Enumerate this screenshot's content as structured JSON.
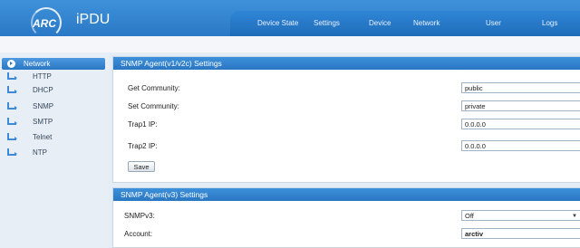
{
  "header": {
    "logo_mark": "ARC",
    "app_title": "iPDU",
    "nav": [
      "Device State",
      "Settings",
      "Device",
      "Network",
      "User",
      "Logs"
    ]
  },
  "sidebar": {
    "items": [
      {
        "label": "Network",
        "active": true
      },
      {
        "label": "HTTP"
      },
      {
        "label": "DHCP"
      },
      {
        "label": "SNMP"
      },
      {
        "label": "SMTP"
      },
      {
        "label": "Telnet"
      },
      {
        "label": "NTP"
      }
    ]
  },
  "snmp_v1v2": {
    "title": "SNMP Agent(v1/v2c) Settings",
    "get_community_label": "Get Community:",
    "get_community_value": "public",
    "set_community_label": "Set Community:",
    "set_community_value": "private",
    "trap1_label": "Trap1 IP:",
    "trap1_value": "0.0.0.0",
    "trap2_label": "Trap2 IP:",
    "trap2_value": "0.0.0.0",
    "save_label": "Save"
  },
  "snmp_v3": {
    "title": "SNMP Agent(v3) Settings",
    "snmpv3_label": "SNMPv3:",
    "snmpv3_value": "Off",
    "account_label": "Account:",
    "account_value": "arctiv"
  },
  "colors": {
    "header_blue": "#2a78c6",
    "panel_title_blue": "#2a76c2"
  }
}
